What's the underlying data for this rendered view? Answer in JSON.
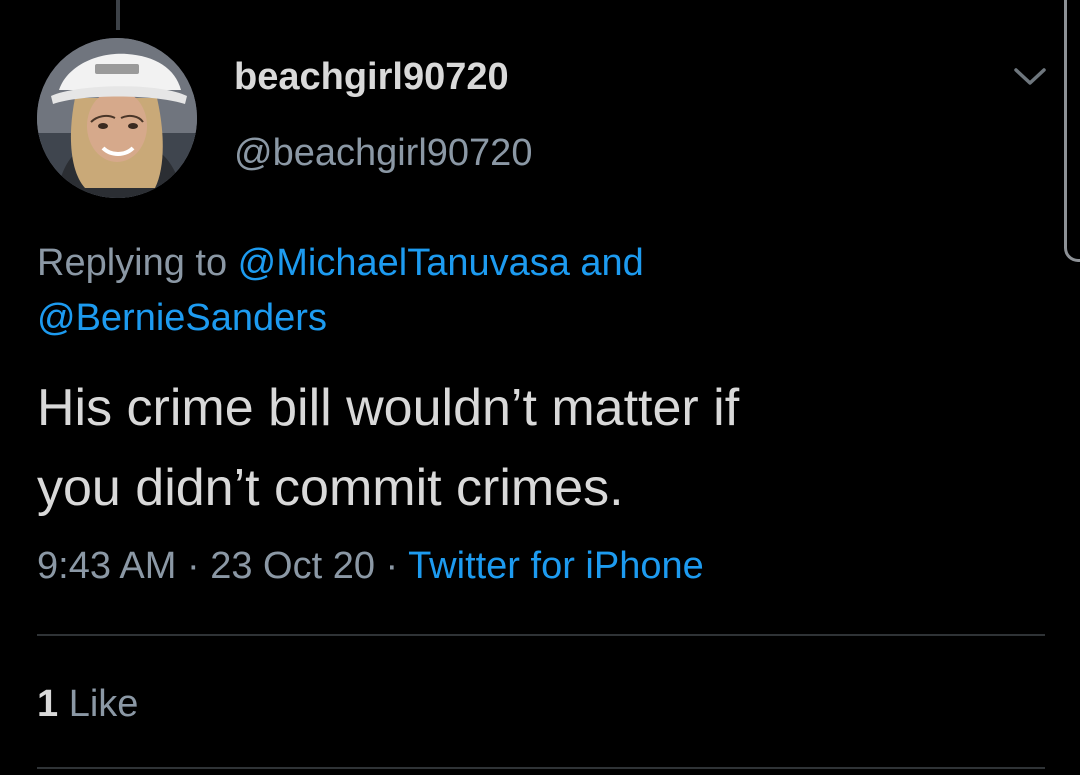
{
  "user": {
    "display_name": "beachgirl90720",
    "handle": "@beachgirl90720",
    "avatar_icon": "profile-photo"
  },
  "reply": {
    "prefix": "Replying to ",
    "mention_1": "@MichaelTanuvasa",
    "joiner": " and",
    "mention_2": "@BernieSanders"
  },
  "tweet": {
    "line_1": "His crime bill wouldn’t matter if",
    "line_2": "you didn’t commit crimes."
  },
  "meta": {
    "time": "9:43 AM",
    "separator_1": " · ",
    "date": "23 Oct 20",
    "separator_2": " · ",
    "source": "Twitter for iPhone"
  },
  "stats": {
    "like_count": "1",
    "like_label": " Like"
  },
  "icons": {
    "menu": "chevron-down-icon"
  },
  "colors": {
    "background": "#000000",
    "primary_text": "#d9d9d9",
    "secondary_text": "#8b98a5",
    "link": "#1d9bf0",
    "divider": "#2f3336"
  }
}
